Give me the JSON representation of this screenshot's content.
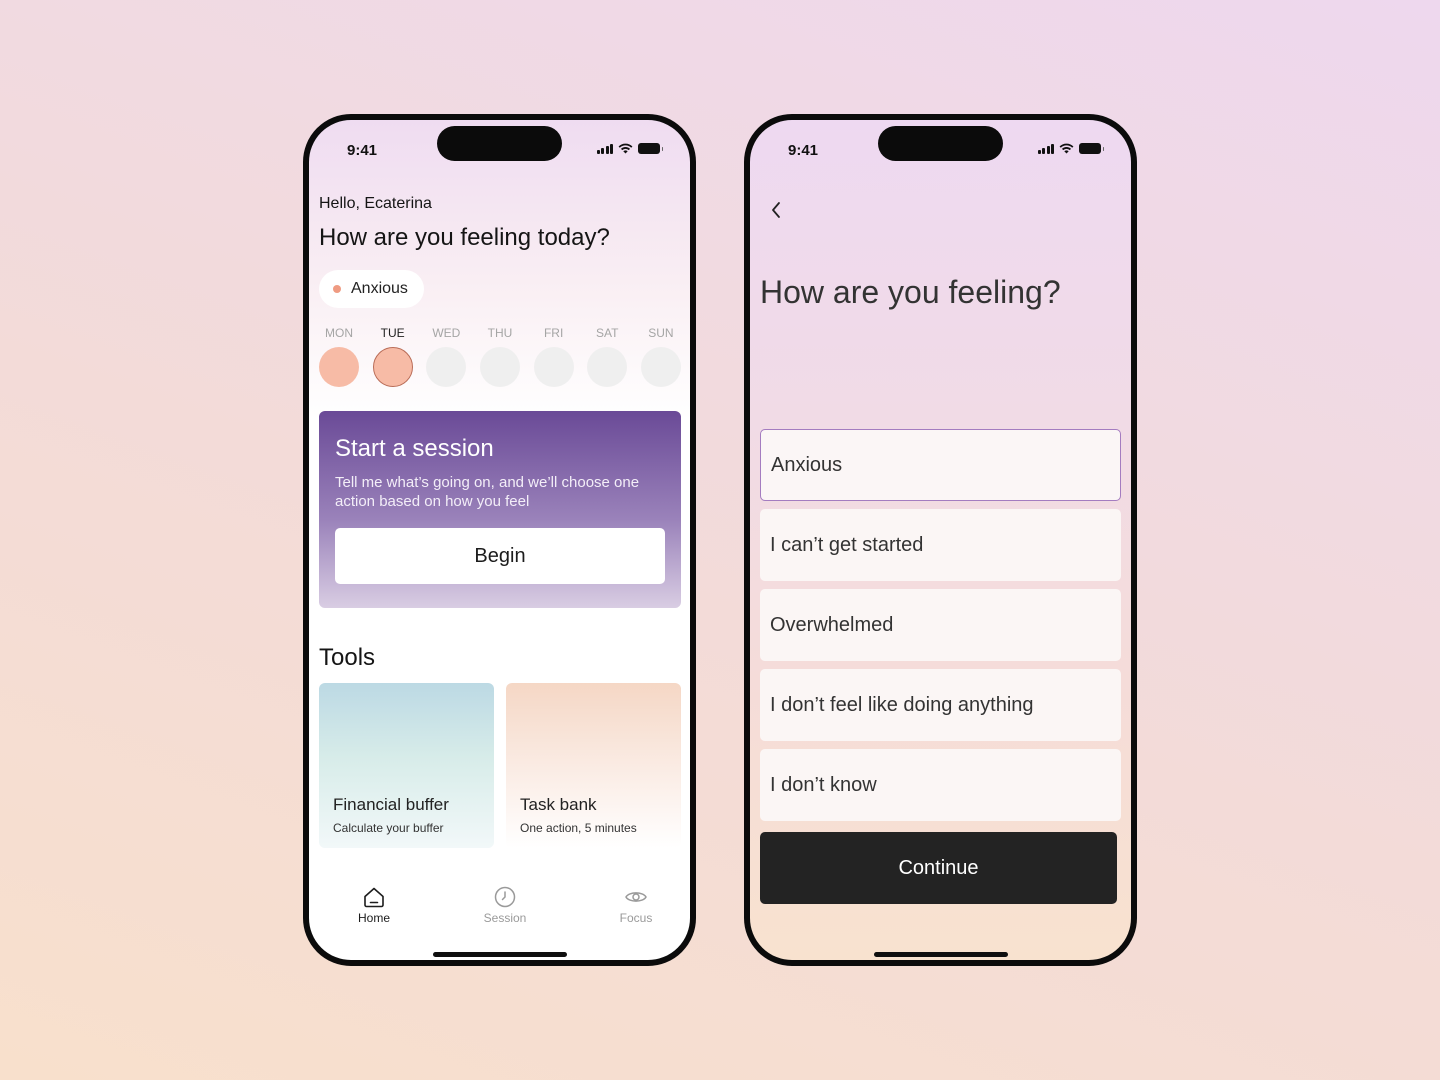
{
  "status_bar": {
    "time": "9:41"
  },
  "home": {
    "greeting": "Hello, Ecaterina",
    "question": "How are you feeling today?",
    "mood_chip": {
      "label": "Anxious",
      "dot_color": "#ef9b82"
    },
    "week": [
      {
        "label": "MON",
        "state": "filled"
      },
      {
        "label": "TUE",
        "state": "selected"
      },
      {
        "label": "WED",
        "state": "empty"
      },
      {
        "label": "THU",
        "state": "empty"
      },
      {
        "label": "FRI",
        "state": "empty"
      },
      {
        "label": "SAT",
        "state": "empty"
      },
      {
        "label": "SUN",
        "state": "empty"
      }
    ],
    "session_card": {
      "title": "Start a session",
      "description": "Tell me what’s going on, and we’ll choose one action based on how you feel",
      "button_label": "Begin"
    },
    "tools": {
      "title": "Tools",
      "items": [
        {
          "name": "Financial buffer",
          "subtitle": "Calculate your buffer"
        },
        {
          "name": "Task bank",
          "subtitle": "One action, 5 minutes"
        }
      ]
    },
    "tabbar": [
      {
        "label": "Home",
        "icon": "home-icon",
        "active": true
      },
      {
        "label": "Session",
        "icon": "clock-icon",
        "active": false
      },
      {
        "label": "Focus",
        "icon": "eye-icon",
        "active": false
      }
    ]
  },
  "feel": {
    "title": "How are you feeling?",
    "options": [
      {
        "label": "Anxious",
        "selected": true
      },
      {
        "label": "I can’t get started",
        "selected": false
      },
      {
        "label": "Overwhelmed",
        "selected": false
      },
      {
        "label": "I don’t feel like doing anything",
        "selected": false
      },
      {
        "label": "I don’t know",
        "selected": false
      }
    ],
    "continue_label": "Continue"
  },
  "colors": {
    "accent_purple": "#6a4a97",
    "mood_peach": "#f7bba6",
    "selected_border": "#a47cc0",
    "continue_button": "#232323"
  }
}
